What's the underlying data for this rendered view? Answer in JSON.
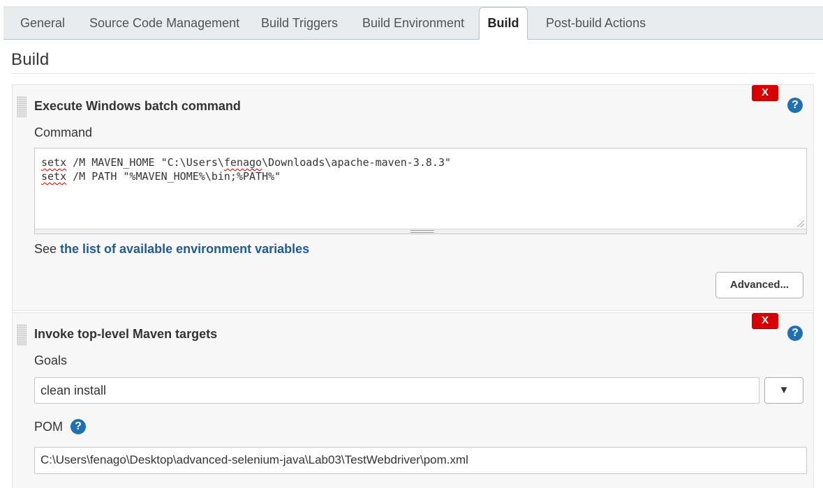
{
  "tabs": [
    {
      "label": "General"
    },
    {
      "label": "Source Code Management"
    },
    {
      "label": "Build Triggers"
    },
    {
      "label": "Build Environment"
    },
    {
      "label": "Build",
      "active": true
    },
    {
      "label": "Post-build Actions"
    }
  ],
  "section": {
    "title": "Build"
  },
  "steps": [
    {
      "title": "Execute Windows batch command",
      "delete_label": "X",
      "help_label": "?",
      "command_label": "Command",
      "command_lines": [
        {
          "cmd": "setx",
          "rest_a": " /M MAVEN_HOME \"C:\\Users\\",
          "user": "fenago",
          "rest_b": "\\Downloads\\apache-maven-3.8.3\""
        },
        {
          "cmd": "setx",
          "rest_a": " /M PATH \"%MAVEN_HOME%\\bin;%PATH%\""
        }
      ],
      "see_prefix": "See ",
      "see_link": "the list of available environment variables",
      "advanced_label": "Advanced..."
    },
    {
      "title": "Invoke top-level Maven targets",
      "delete_label": "X",
      "help_label": "?",
      "goals_label": "Goals",
      "goals_value": "clean install",
      "dropdown_icon": "▼",
      "pom_label": "POM",
      "pom_help": "?",
      "pom_value": "C:\\Users\\fenago\\Desktop\\advanced-selenium-java\\Lab03\\TestWebdriver\\pom.xml"
    }
  ],
  "colors": {
    "delete": "#d80000",
    "help": "#1f6fb2",
    "link": "#1f5b94"
  }
}
